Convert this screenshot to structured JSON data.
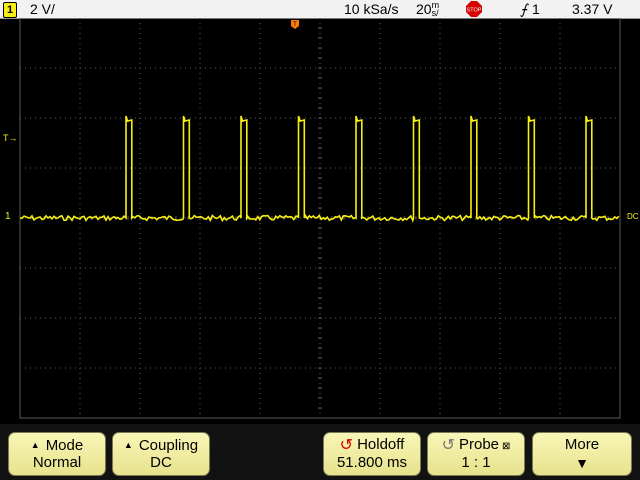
{
  "status": {
    "channel_number": "1",
    "volts_per_div": "2 V/",
    "sample_rate": "10 kSa/s",
    "time_per_div": "20",
    "time_unit_top": "m",
    "time_unit_bottom": "s/",
    "trigger_slope": "⨍",
    "trigger_source": "1",
    "trigger_level": "3.37  V",
    "run_state": "STOP"
  },
  "markers": {
    "trigger_position": "T",
    "trigger_level_marker": "T→",
    "channel_ground": "1",
    "coupling_tag": "DC"
  },
  "softkeys": {
    "mode": {
      "label": "Mode",
      "value": "Normal"
    },
    "coupling": {
      "label": "Coupling",
      "value": "DC"
    },
    "holdoff": {
      "label": "Holdoff",
      "value": "51.800 ms"
    },
    "probe": {
      "label": "Probe",
      "value": "1 : 1"
    },
    "more": {
      "label": "More",
      "arrow": "▼"
    }
  },
  "colors": {
    "trace": "#f7ef12",
    "grid": "#5a5a5a",
    "trigger_marker": "#ff7a00",
    "softkey_face": "#f3efa6",
    "stop_red": "#d50000"
  },
  "waveform": {
    "type": "pulse_train",
    "low_divisions": 0,
    "high_divisions": 2,
    "pulse_count": 9
  }
}
